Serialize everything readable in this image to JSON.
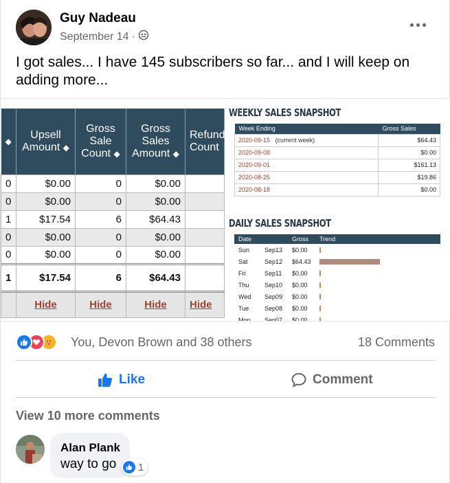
{
  "post": {
    "author": "Guy Nadeau",
    "date": "September 14",
    "separator": "·",
    "text": "I got sales... I have 145 subscribers so far... and I will keep on adding more..."
  },
  "photo": {
    "table": {
      "headers": [
        {
          "line1": "",
          "line2": "",
          "sortable": true
        },
        {
          "line1": "Upsell",
          "line2": "Amount",
          "sortable": true
        },
        {
          "line1": "Gross",
          "line2": "Sale",
          "line3": "Count",
          "sortable": true
        },
        {
          "line1": "Gross",
          "line2": "Sales",
          "line3": "Amount",
          "sortable": true
        },
        {
          "line1": "Refund",
          "line2": "Count",
          "sortable": false
        }
      ],
      "rows": [
        [
          "0",
          "$0.00",
          "0",
          "$0.00",
          ""
        ],
        [
          "0",
          "$0.00",
          "0",
          "$0.00",
          ""
        ],
        [
          "1",
          "$17.54",
          "6",
          "$64.43",
          ""
        ],
        [
          "0",
          "$0.00",
          "0",
          "$0.00",
          ""
        ],
        [
          "0",
          "$0.00",
          "0",
          "$0.00",
          ""
        ]
      ],
      "total": [
        "1",
        "$17.54",
        "6",
        "$64.43",
        ""
      ],
      "hide_label": "Hide"
    },
    "weekly": {
      "title": "WEEKLY SALES SNAPSHOT",
      "col_week": "Week Ending",
      "col_gross": "Gross Sales",
      "rows": [
        {
          "week": "2020-09-15",
          "note": "(current week)",
          "gross": "$64.43"
        },
        {
          "week": "2020-09-08",
          "note": "",
          "gross": "$0.00"
        },
        {
          "week": "2020-09-01",
          "note": "",
          "gross": "$161.13"
        },
        {
          "week": "2020-08-25",
          "note": "",
          "gross": "$19.86"
        },
        {
          "week": "2020-08-18",
          "note": "",
          "gross": "$0.00"
        }
      ]
    },
    "daily": {
      "title": "DAILY SALES SNAPSHOT",
      "col_date": "Date",
      "col_gross": "Gross",
      "col_trend": "Trend",
      "rows": [
        {
          "day": "Sun",
          "date": "Sep13",
          "gross": "$0.00",
          "trend": 0
        },
        {
          "day": "Sat",
          "date": "Sep12",
          "gross": "$64.43",
          "trend": 1.0
        },
        {
          "day": "Fri",
          "date": "Sep11",
          "gross": "$0.00",
          "trend": 0
        },
        {
          "day": "Thu",
          "date": "Sep10",
          "gross": "$0.00",
          "trend": 0
        },
        {
          "day": "Wed",
          "date": "Sep09",
          "gross": "$0.00",
          "trend": 0
        },
        {
          "day": "Tue",
          "date": "Sep08",
          "gross": "$0.00",
          "trend": 0
        },
        {
          "day": "Mon",
          "date": "Sep07",
          "gross": "$0.00",
          "trend": 0
        }
      ]
    }
  },
  "reactions": {
    "summary": "You, Devon Brown and 38 others",
    "comments": "18 Comments",
    "types": [
      "like-icon",
      "love-icon",
      "care-icon"
    ],
    "colors": {
      "like": "#1877f2",
      "love": "#f33e58",
      "care": "#f7b125"
    }
  },
  "actions": {
    "like": "Like",
    "comment": "Comment"
  },
  "comments": {
    "view_more": "View 10 more comments",
    "items": [
      {
        "author": "Alan Plank",
        "text": "way to go",
        "reaction_count": "1"
      }
    ]
  }
}
